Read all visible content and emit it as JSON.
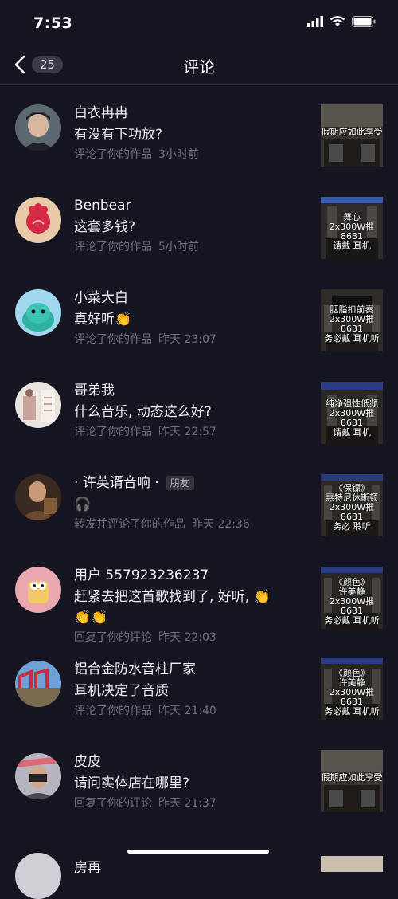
{
  "status": {
    "time": "7:53"
  },
  "nav": {
    "back_count": "25",
    "title": "评论"
  },
  "items": [
    {
      "name": "白衣冉冉",
      "content": "有没有下功放?",
      "action": "评论了你的作品",
      "time": "3小时前",
      "thumb_text": "假期应如此享受"
    },
    {
      "name": "Benbear",
      "content": "这套多钱?",
      "action": "评论了你的作品",
      "time": "5小时前",
      "thumb_text": "舞心\n2x300W推8631\n请戴  耳机"
    },
    {
      "name": "小菜大白",
      "content": "真好听👏",
      "action": "评论了你的作品",
      "time": "昨天 23:07",
      "thumb_text": "胭脂扣前奏\n2x300W推8631\n务必戴  耳机听"
    },
    {
      "name": "哥弟我",
      "content": "什么音乐, 动态这么好?",
      "action": "评论了你的作品",
      "time": "昨天 22:57",
      "thumb_text": "纯净强性低频\n2x300W推8631\n请戴  耳机"
    },
    {
      "name": "· 许英谞音响 ·",
      "friend": "朋友",
      "content": "🎧",
      "action": "转发并评论了你的作品",
      "time": "昨天 22:36",
      "thumb_text": "《保镖》\n惠特尼休斯顿\n2x300W推8631\n务必  聆听"
    },
    {
      "name": "用户 557923236237",
      "content": "赶紧去把这首歌找到了, 好听, 👏\n👏👏",
      "action": "回复了你的评论",
      "time": "昨天 22:03",
      "thumb_text": "《颜色》\n许美静\n2x300W推8631\n务必戴  耳机听"
    },
    {
      "name": "铝合金防水音柱厂家",
      "content": "耳机决定了音质",
      "action": "评论了你的作品",
      "time": "昨天 21:40",
      "thumb_text": "《颜色》\n许美静\n2x300W推8631\n务必戴  耳机听"
    },
    {
      "name": "皮皮",
      "content": "请问实体店在哪里?",
      "action": "回复了你的评论",
      "time": "昨天 21:37",
      "thumb_text": "假期应如此享受"
    },
    {
      "name": "房再"
    }
  ]
}
